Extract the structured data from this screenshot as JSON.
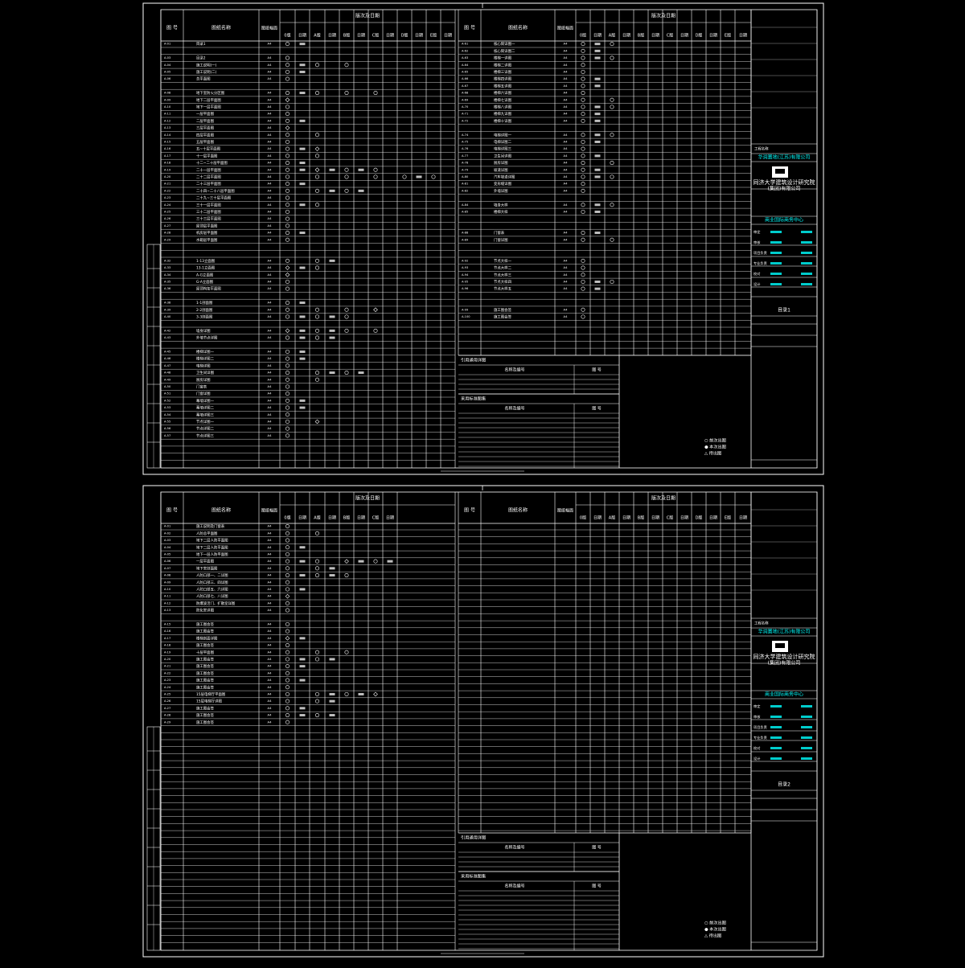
{
  "sheets": [
    {
      "id": "sheet-1",
      "left_header": {
        "tuhao": "图 号",
        "name": "图纸名称",
        "size": "图纸幅面",
        "group": "版次及日期",
        "cols": [
          "0版",
          "日期",
          "A版",
          "日期",
          "B版",
          "日期",
          "C版",
          "日期",
          "D版",
          "日期",
          "E版",
          "日期"
        ]
      },
      "right_header": {
        "tuhao": "图 号",
        "name": "图纸名称",
        "size": "图纸幅面",
        "group": "版次及日期",
        "cols": [
          "0版",
          "日期",
          "A版",
          "日期",
          "B版",
          "日期",
          "C版",
          "日期",
          "D版",
          "日期",
          "E版",
          "日期"
        ]
      },
      "left_rows": [
        {
          "name": "目录1",
          "size": "A4"
        },
        {
          "name": "",
          "size": ""
        },
        {
          "name": "目录2",
          "size": "A4"
        },
        {
          "name": "施工说明(一)",
          "size": "A4"
        },
        {
          "name": "施工说明(二)",
          "size": "A4"
        },
        {
          "name": "总平面图",
          "size": "A4"
        },
        {
          "name": "",
          "size": ""
        },
        {
          "name": "地下室防火分区图",
          "size": "A4"
        },
        {
          "name": "地下二层平面图",
          "size": "A4"
        },
        {
          "name": "地下一层平面图",
          "size": "A4"
        },
        {
          "name": "一层平面图",
          "size": "A4"
        },
        {
          "name": "二层平面图",
          "size": "A4"
        },
        {
          "name": "三层平面图",
          "size": "A4"
        },
        {
          "name": "四层平面图",
          "size": "A4"
        },
        {
          "name": "五层平面图",
          "size": "A4"
        },
        {
          "name": "五~十层平面图",
          "size": "A4"
        },
        {
          "name": "十一层平面图",
          "size": "A4"
        },
        {
          "name": "十二~二十层平面图",
          "size": "A4"
        },
        {
          "name": "二十一层平面图",
          "size": "A4"
        },
        {
          "name": "二十二层平面图",
          "size": "A4"
        },
        {
          "name": "二十三层平面图",
          "size": "A4"
        },
        {
          "name": "二十四~二十八层平面图",
          "size": "A4"
        },
        {
          "name": "二十九~三十层平面图",
          "size": "A4"
        },
        {
          "name": "三十一层平面图",
          "size": "A4"
        },
        {
          "name": "三十二层平面图",
          "size": "A4"
        },
        {
          "name": "三十三层平面图",
          "size": "A4"
        },
        {
          "name": "屋顶层平面图",
          "size": "A4"
        },
        {
          "name": "机房层平面图",
          "size": "A4"
        },
        {
          "name": "水箱层平面图",
          "size": "A4"
        },
        {
          "name": "",
          "size": ""
        },
        {
          "name": "",
          "size": ""
        },
        {
          "name": "1-13立面图",
          "size": "A4"
        },
        {
          "name": "13-1立面图",
          "size": "A4"
        },
        {
          "name": "A-G立面图",
          "size": "A4"
        },
        {
          "name": "G-A立面图",
          "size": "A4"
        },
        {
          "name": "屋顶构架平面图",
          "size": "A4"
        },
        {
          "name": "",
          "size": ""
        },
        {
          "name": "1-1剖面图",
          "size": "A4"
        },
        {
          "name": "2-2剖面图",
          "size": "A4"
        },
        {
          "name": "3-3剖面图",
          "size": "A4"
        },
        {
          "name": "",
          "size": ""
        },
        {
          "name": "墙身详图",
          "size": "A4"
        },
        {
          "name": "外墙节点详图",
          "size": "A4"
        },
        {
          "name": "",
          "size": ""
        },
        {
          "name": "楼梯详图一",
          "size": "A4"
        },
        {
          "name": "楼梯详图二",
          "size": "A4"
        },
        {
          "name": "电梯详图",
          "size": "A4"
        },
        {
          "name": "卫生间详图",
          "size": "A4"
        },
        {
          "name": "厨房详图",
          "size": "A4"
        },
        {
          "name": "门窗表",
          "size": "A4"
        },
        {
          "name": "门窗详图",
          "size": "A4"
        },
        {
          "name": "幕墙详图一",
          "size": "A4"
        },
        {
          "name": "幕墙详图二",
          "size": "A4"
        },
        {
          "name": "幕墙详图三",
          "size": "A4"
        },
        {
          "name": "节点详图一",
          "size": "A4"
        },
        {
          "name": "节点详图二",
          "size": "A4"
        },
        {
          "name": "节点详图三",
          "size": "A4"
        }
      ],
      "right_rows": [
        {
          "name": "核心筒详图一",
          "size": "A4"
        },
        {
          "name": "核心筒详图二",
          "size": "A4"
        },
        {
          "name": "楼梯一详图",
          "size": "A4"
        },
        {
          "name": "楼梯二详图",
          "size": "A4"
        },
        {
          "name": "楼梯三详图",
          "size": "A4"
        },
        {
          "name": "楼梯四详图",
          "size": "A4"
        },
        {
          "name": "楼梯五详图",
          "size": "A4"
        },
        {
          "name": "楼梯六详图",
          "size": "A4"
        },
        {
          "name": "楼梯七详图",
          "size": "A4"
        },
        {
          "name": "楼梯八详图",
          "size": "A4"
        },
        {
          "name": "楼梯九详图",
          "size": "A4"
        },
        {
          "name": "楼梯十详图",
          "size": "A4"
        },
        {
          "name": "",
          "size": ""
        },
        {
          "name": "电梯详图一",
          "size": "A4"
        },
        {
          "name": "电梯详图二",
          "size": "A4"
        },
        {
          "name": "电梯详图三",
          "size": "A4"
        },
        {
          "name": "卫生间详图",
          "size": "A4"
        },
        {
          "name": "厨房详图",
          "size": "A4"
        },
        {
          "name": "坡道详图",
          "size": "A4"
        },
        {
          "name": "汽车坡道详图",
          "size": "A4"
        },
        {
          "name": "变形缝详图",
          "size": "A4"
        },
        {
          "name": "外墙详图",
          "size": "A4"
        },
        {
          "name": "",
          "size": ""
        },
        {
          "name": "墙身大样",
          "size": "A4"
        },
        {
          "name": "楼梯大样",
          "size": "A4"
        },
        {
          "name": "",
          "size": ""
        },
        {
          "name": "",
          "size": ""
        },
        {
          "name": "门窗表",
          "size": "A4"
        },
        {
          "name": "门窗详图",
          "size": "A4"
        },
        {
          "name": "",
          "size": ""
        },
        {
          "name": "",
          "size": ""
        },
        {
          "name": "节点大样一",
          "size": "A4"
        },
        {
          "name": "节点大样二",
          "size": "A4"
        },
        {
          "name": "节点大样三",
          "size": "A4"
        },
        {
          "name": "节点大样四",
          "size": "A4"
        },
        {
          "name": "节点大样五",
          "size": "A4"
        },
        {
          "name": "",
          "size": ""
        },
        {
          "name": "",
          "size": ""
        },
        {
          "name": "施工图会签",
          "size": "A4"
        },
        {
          "name": "施工图会签",
          "size": "A4"
        }
      ],
      "ref_title": "引用通用详图",
      "ref_cols": [
        "名称及编号",
        "图 号"
      ],
      "ref2_title": "采用标准图集",
      "ref2_cols": [
        "名称及编号",
        "图 号"
      ],
      "legend": [
        "○ 前次出图",
        "● 本次出图",
        "△ 待出图"
      ],
      "sheet_title": "目录1"
    },
    {
      "id": "sheet-2",
      "left_header": {
        "tuhao": "图 号",
        "name": "图纸名称",
        "size": "图纸幅面",
        "group": "版次及日期",
        "cols": [
          "0版",
          "日期",
          "A版",
          "日期",
          "B版",
          "日期",
          "C版",
          "日期"
        ]
      },
      "right_header": {
        "tuhao": "图 号",
        "name": "图纸名称",
        "size": "图纸幅面",
        "group": "版次及日期",
        "cols": [
          "0版",
          "日期",
          "A版",
          "日期",
          "B版",
          "日期",
          "C版",
          "日期",
          "D版",
          "日期",
          "E版",
          "日期"
        ]
      },
      "left_rows": [
        {
          "name": "施工说明及门窗表",
          "size": "A4"
        },
        {
          "name": "人防总平面图",
          "size": "A4"
        },
        {
          "name": "地下二层人防平面图",
          "size": "A4"
        },
        {
          "name": "地下二层人防平面图",
          "size": "A4"
        },
        {
          "name": "地下一层人防平面图",
          "size": "A4"
        },
        {
          "name": "一层平面图",
          "size": "A4"
        },
        {
          "name": "地下室剖面图",
          "size": "A4"
        },
        {
          "name": "人防口部一、二详图",
          "size": "A4"
        },
        {
          "name": "人防口部三、四详图",
          "size": "A4"
        },
        {
          "name": "人防口部五、六详图",
          "size": "A4"
        },
        {
          "name": "人防口部七、八详图",
          "size": "A4"
        },
        {
          "name": "防爆波活门、扩散室详图",
          "size": "A4"
        },
        {
          "name": "防化室详图",
          "size": "A4"
        },
        {
          "name": "",
          "size": ""
        },
        {
          "name": "施工图会签",
          "size": "A4"
        },
        {
          "name": "施工图会签",
          "size": "A4"
        },
        {
          "name": "楼梯剖面详图",
          "size": "A4"
        },
        {
          "name": "施工图会签",
          "size": "A4"
        },
        {
          "name": "十层平面图",
          "size": "A4"
        },
        {
          "name": "施工图会签",
          "size": "A4"
        },
        {
          "name": "施工图会签",
          "size": "A4"
        },
        {
          "name": "施工图会签",
          "size": "A4"
        },
        {
          "name": "施工图会签",
          "size": "A4"
        },
        {
          "name": "施工图会签",
          "size": "A4"
        },
        {
          "name": "15层电梯厅平面图",
          "size": "A4"
        },
        {
          "name": "15层电梯厅详图",
          "size": "A4"
        },
        {
          "name": "施工图会签",
          "size": "A4"
        },
        {
          "name": "施工图会签",
          "size": "A4"
        },
        {
          "name": "施工图会签",
          "size": "A4"
        }
      ],
      "right_rows": [],
      "ref_title": "引用通用详图",
      "ref_cols": [
        "名称及编号",
        "图 号"
      ],
      "ref2_title": "采用标准图集",
      "ref2_cols": [
        "名称及编号",
        "图 号"
      ],
      "legend": [
        "○ 前次出图",
        "● 本次出图",
        "△ 待出图"
      ],
      "sheet_title": "目录2"
    }
  ],
  "title_block": {
    "project_label": "工程名称",
    "client": "华润置地(江苏)有限公司",
    "institute_name": "同济大学建筑设计研究院",
    "institute_sub": "(集团)有限公司",
    "project_name": "商业国际商务中心",
    "roles": [
      "审定",
      "审核",
      "项目负责",
      "专业负责",
      "校对",
      "设计"
    ]
  },
  "colors": {
    "background": "#000000",
    "line": "#ffffff",
    "accent": "#00ffff"
  }
}
